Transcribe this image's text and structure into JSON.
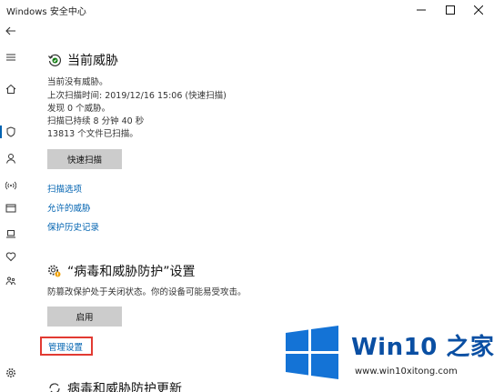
{
  "window": {
    "title": "Windows 安全中心"
  },
  "icons": {
    "back": "back-arrow-icon",
    "menu": "hamburger-menu-icon",
    "home": "home-icon",
    "shield": "shield-icon",
    "person": "person-icon",
    "wireless": "wireless-icon",
    "browser": "browser-window-icon",
    "device": "laptop-icon",
    "health": "heart-icon",
    "family": "family-icon",
    "settings": "gear-icon"
  },
  "colors": {
    "accent": "#0063b1",
    "highlight_box": "#e23a32",
    "button_bg": "#cccccc"
  },
  "threats": {
    "heading": "当前威胁",
    "lines": [
      "当前没有威胁。",
      "上次扫描时间: 2019/12/16 15:06 (快速扫描)",
      "发现 0 个威胁。",
      "扫描已持续 8 分钟 40 秒",
      "13813 个文件已扫描。"
    ],
    "quick_scan_label": "快速扫描",
    "links": [
      "扫描选项",
      "允许的威胁",
      "保护历史记录"
    ]
  },
  "settings": {
    "heading": "“病毒和威胁防护”设置",
    "status_text": "防篡改保护处于关闭状态。你的设备可能易受攻击。",
    "enable_label": "启用",
    "manage_link": "管理设置"
  },
  "updates": {
    "heading": "病毒和威胁防护更新"
  },
  "watermark": {
    "brand": "Win10 之家",
    "url": "www.win10xitong.com"
  }
}
